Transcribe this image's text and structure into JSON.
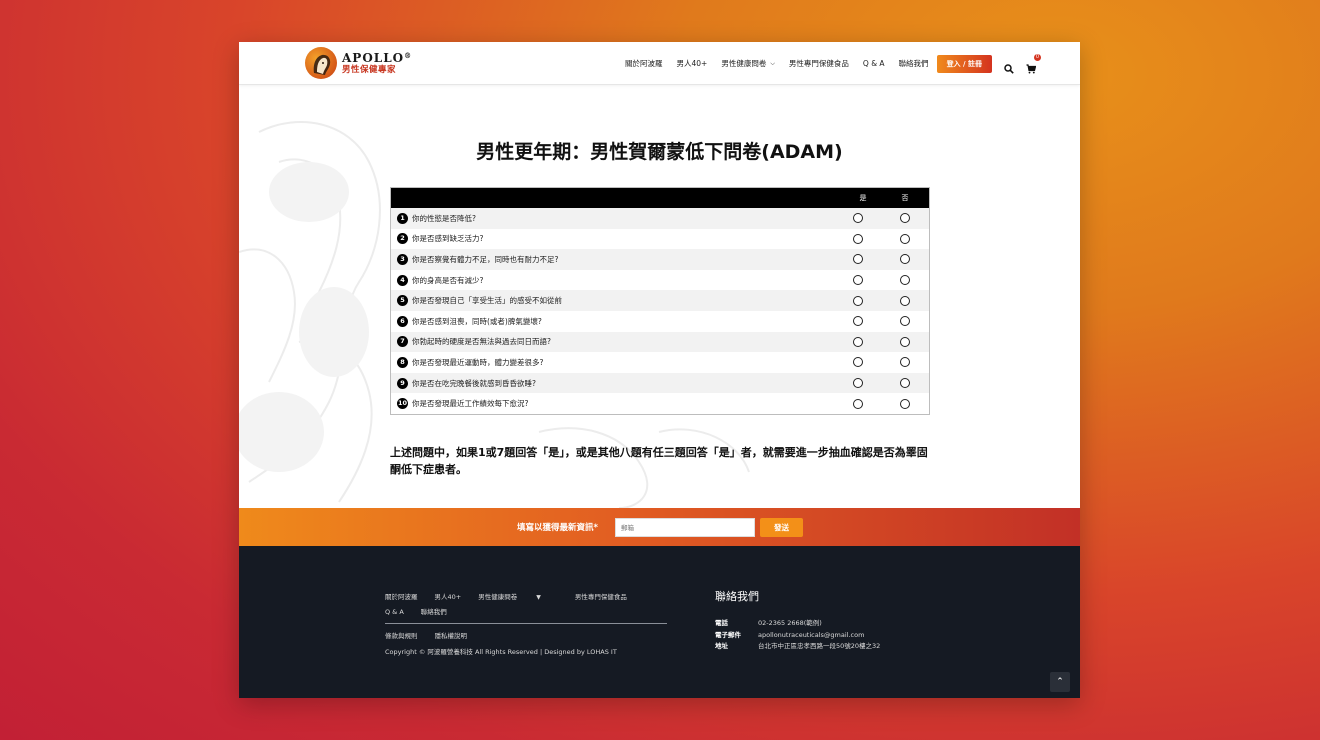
{
  "header": {
    "logo_title": "APOLLO",
    "logo_reg": "®",
    "logo_sub": "男性保健專家",
    "nav": [
      {
        "label": "關於阿波羅",
        "dropdown": false
      },
      {
        "label": "男人40+",
        "dropdown": false
      },
      {
        "label": "男性健康問卷",
        "dropdown": true
      },
      {
        "label": "男性專門保健食品",
        "dropdown": false
      },
      {
        "label": "Q & A",
        "dropdown": false
      },
      {
        "label": "聯絡我們",
        "dropdown": false
      }
    ],
    "login_label": "登入 / 註冊",
    "cart_count": "0"
  },
  "main": {
    "title": "男性更年期：男性賀爾蒙低下問卷(ADAM)",
    "table": {
      "col_yes": "是",
      "col_no": "否",
      "questions": [
        {
          "num": "1",
          "text": "你的性慾是否降低?"
        },
        {
          "num": "2",
          "text": "你是否感到缺乏活力?"
        },
        {
          "num": "3",
          "text": "你是否察覺有體力不足，同時也有耐力不足?"
        },
        {
          "num": "4",
          "text": "你的身高是否有減少?"
        },
        {
          "num": "5",
          "text": "你是否發現自己「享受生活」的感受不如從前"
        },
        {
          "num": "6",
          "text": "你是否感到沮喪，同時(或者)脾氣變壞?"
        },
        {
          "num": "7",
          "text": "你勃起時的硬度是否無法與過去同日而語?"
        },
        {
          "num": "8",
          "text": "你是否發現最近運動時，體力變差很多?"
        },
        {
          "num": "9",
          "text": "你是否在吃完晚餐後就感到昏昏欲睡?"
        },
        {
          "num": "10",
          "text": "你是否發現最近工作績效每下愈況?"
        }
      ]
    },
    "note": "上述問題中，如果1或7題回答「是」，或是其他八題有任三題回答「是」者，就需要進一步抽血確認是否為睪固酮低下症患者。"
  },
  "subscribe": {
    "label": "填寫以獲得最新資訊*",
    "placeholder": "郵箱",
    "button": "發送"
  },
  "footer": {
    "nav": [
      "關於阿波羅",
      "男人40+",
      "男性健康問卷",
      "男性專門保健食品",
      "Q & A",
      "聯絡我們"
    ],
    "links": [
      "條款與規則",
      "隱私權說明"
    ],
    "copyright": "Copyright © 阿波羅營養科技 All Rights Reserved | Designed by LOHAS IT",
    "contact_title": "聯絡我們",
    "contact": [
      {
        "key": "電話",
        "value": "02-2365 2668(範例)"
      },
      {
        "key": "電子郵件",
        "value": "apollonutraceuticals@gmail.com"
      },
      {
        "key": "地址",
        "value": "台北市中正區忠孝西路一段50號20樓之32"
      }
    ]
  },
  "colors": {
    "accent_orange": "#ef8a1b",
    "accent_red": "#c23026",
    "footer_bg": "#151a23"
  }
}
